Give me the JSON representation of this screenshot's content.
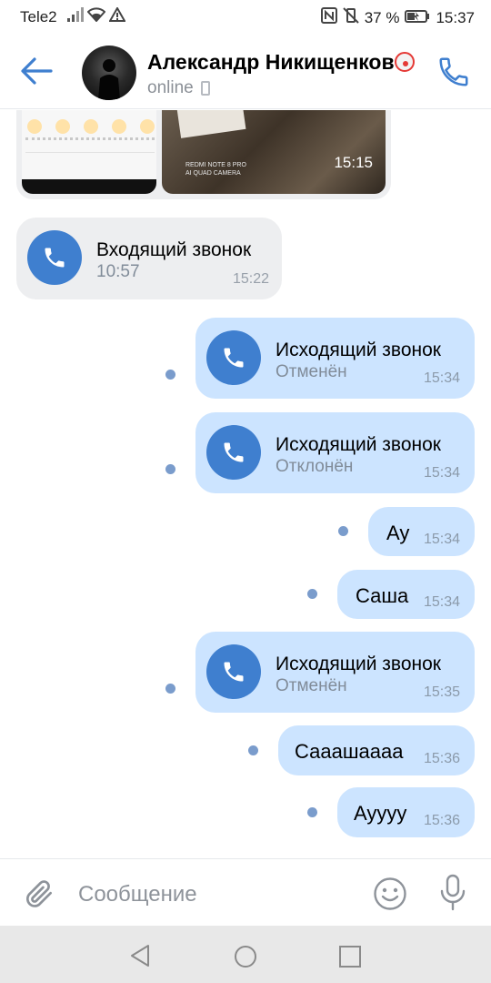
{
  "status_bar": {
    "carrier": "Tele2",
    "battery": "37 %",
    "time": "15:37"
  },
  "header": {
    "name": "Александр Никищенков",
    "presence": "online",
    "accent_color": "#3f7fcf"
  },
  "top_media": {
    "duration": "15:15",
    "watermark_line1": "REDMI NOTE 8 PRO",
    "watermark_line2": "AI QUAD CAMERA"
  },
  "messages": [
    {
      "kind": "call",
      "direction": "in",
      "title": "Входящий звонок",
      "sub": "10:57",
      "time": "15:22"
    },
    {
      "kind": "call",
      "direction": "out",
      "title": "Исходящий звонок",
      "sub": "Отменён",
      "time": "15:34"
    },
    {
      "kind": "call",
      "direction": "out",
      "title": "Исходящий звонок",
      "sub": "Отклонён",
      "time": "15:34"
    },
    {
      "kind": "text",
      "direction": "out",
      "text": "Ау",
      "time": "15:34"
    },
    {
      "kind": "text",
      "direction": "out",
      "text": "Саша",
      "time": "15:34"
    },
    {
      "kind": "call",
      "direction": "out",
      "title": "Исходящий звонок",
      "sub": "Отменён",
      "time": "15:35"
    },
    {
      "kind": "text",
      "direction": "out",
      "text": "Сааашаааа",
      "time": "15:36"
    },
    {
      "kind": "text",
      "direction": "out",
      "text": "Ауууу",
      "time": "15:36"
    }
  ],
  "composer": {
    "placeholder": "Сообщение"
  },
  "icons": {
    "back": "back-arrow-icon",
    "call": "phone-icon",
    "attach": "paperclip-icon",
    "emoji": "smiley-icon",
    "mic": "microphone-icon"
  }
}
